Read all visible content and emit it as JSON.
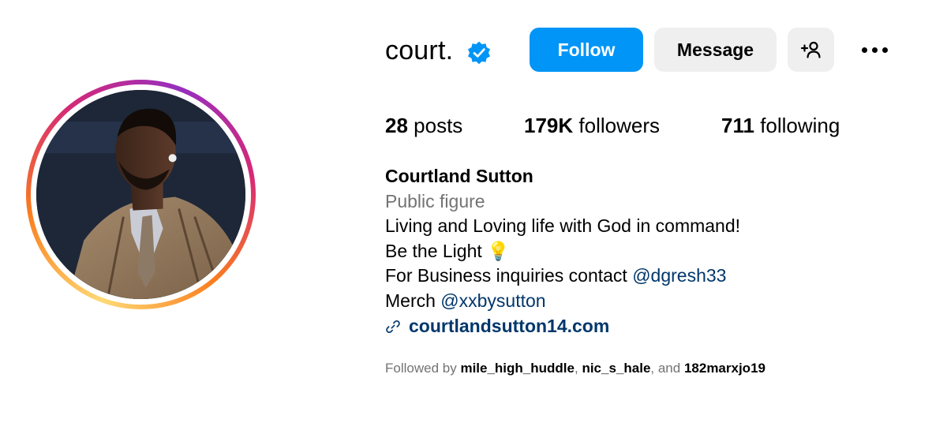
{
  "profile": {
    "username": "court.",
    "verified": true,
    "display_name": "Courtland Sutton",
    "category": "Public figure"
  },
  "actions": {
    "follow_label": "Follow",
    "message_label": "Message",
    "add_user_label": "+‍",
    "more_icon": "more-horizontal-icon"
  },
  "stats": {
    "posts_count": "28",
    "posts_label": "posts",
    "followers_count": "179K",
    "followers_label": "followers",
    "following_count": "711",
    "following_label": "following"
  },
  "bio": {
    "line1": "Living and Loving life with God in command!",
    "line2": "Be the Light",
    "line2_emoji": "💡",
    "line3_prefix": "For Business inquiries contact",
    "line3_mention": "@dgresh33",
    "line4_prefix": "Merch",
    "line4_mention": "@xxbysutton",
    "website": "courtlandsutton14.com"
  },
  "followed_by": {
    "prefix": "Followed by",
    "user1": "mile_high_huddle",
    "sep": ",",
    "user2": "nic_s_hale",
    "and": ", and",
    "user3": "182marxjo19"
  },
  "colors": {
    "follow_button": "#0095f6",
    "secondary_button": "#efefef",
    "link": "#00376b",
    "muted_text": "#737373",
    "verified_badge": "#0095f6"
  }
}
